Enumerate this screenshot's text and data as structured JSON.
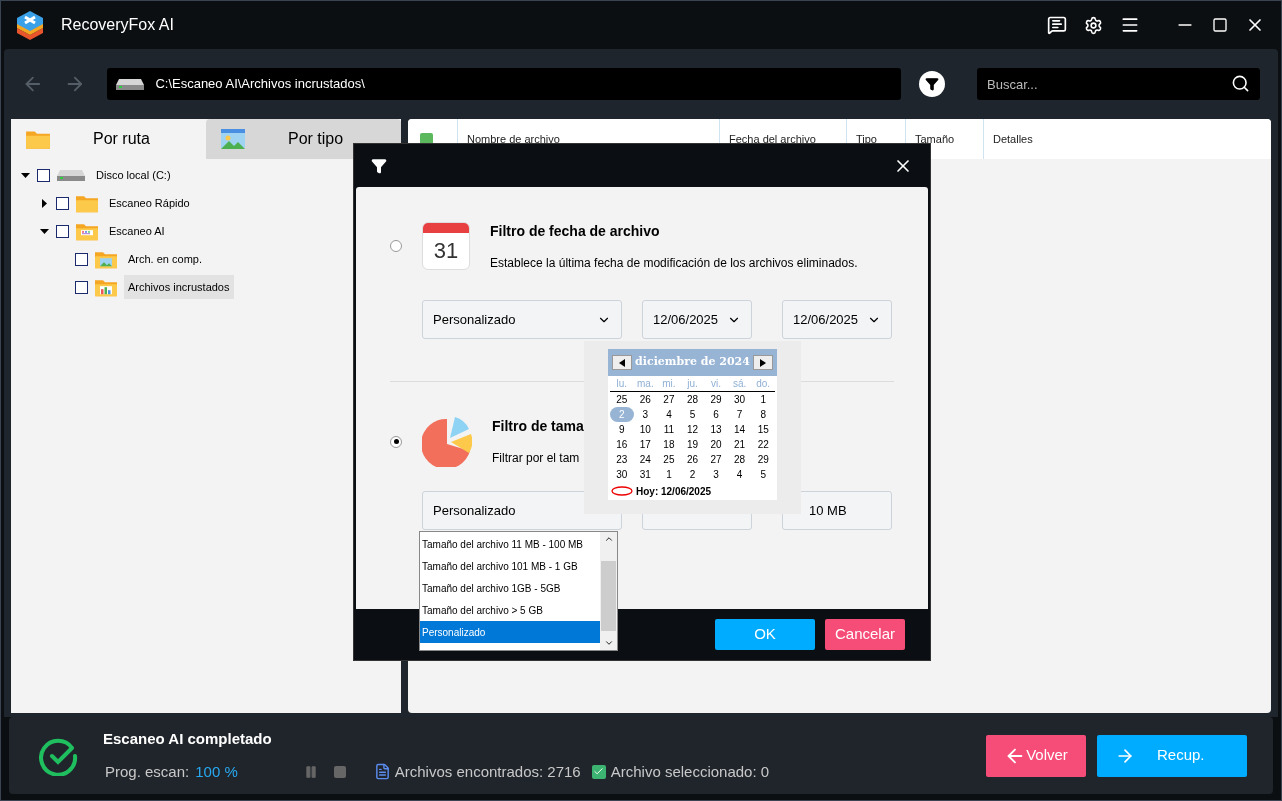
{
  "window": {
    "title": "RecoveryFox AI"
  },
  "toolbar": {
    "path": "C:\\Escaneo AI\\Archivos incrustados\\",
    "search": {
      "placeholder": "Buscar..."
    }
  },
  "tabs": [
    {
      "label": "Por ruta",
      "selected": true,
      "kind": "folder"
    },
    {
      "label": "Por tipo",
      "selected": false,
      "kind": "image"
    }
  ],
  "tree": [
    {
      "label": "Disco local (C:)",
      "kind": "drive",
      "checked": false,
      "expanded": true,
      "selected": false,
      "children": [
        {
          "label": "Escaneo Rápido",
          "kind": "folder",
          "checked": false,
          "expanded": false,
          "selected": false
        },
        {
          "label": "Escaneo AI",
          "kind": "ai-folder",
          "checked": false,
          "expanded": true,
          "selected": false,
          "children": [
            {
              "label": "Arch. en comp.",
              "kind": "image-folder",
              "checked": false,
              "selected": false
            },
            {
              "label": "Archivos incrustados",
              "kind": "chart-folder",
              "checked": false,
              "selected": true
            }
          ]
        }
      ]
    }
  ],
  "table": {
    "select_all": {
      "checked": false
    },
    "columns": [
      "Nombre de archivo",
      "Fecha del archivo",
      "Tipo",
      "Tamaño",
      "Detalles"
    ]
  },
  "filter_dialog": {
    "date_filter": {
      "selected": false,
      "icon_day": "31",
      "title": "Filtro de fecha de archivo",
      "description": "Establece la última fecha de modificación de los archivos eliminados.",
      "preset": "Personalizado",
      "from": "12/06/2025",
      "to": "12/06/2025"
    },
    "size_filter": {
      "selected": true,
      "title": "Filtro de tama",
      "description": "Filtrar por el tam",
      "preset": "Personalizado",
      "max": "10 MB"
    },
    "size_options": [
      {
        "label": "Tamaño del archivo 11 MB - 100 MB",
        "selected": false
      },
      {
        "label": "Tamaño del archivo 101 MB - 1 GB",
        "selected": false
      },
      {
        "label": "Tamaño del archivo 1GB - 5GB",
        "selected": false
      },
      {
        "label": "Tamaño del archivo > 5 GB",
        "selected": false
      },
      {
        "label": "Personalizado",
        "selected": true
      }
    ],
    "calendar": {
      "month": "diciembre de 2024",
      "weekdays": [
        "lu.",
        "ma.",
        "mi.",
        "ju.",
        "vi.",
        "sá.",
        "do."
      ],
      "days": [
        {
          "d": "25",
          "selected": false
        },
        {
          "d": "26",
          "selected": false
        },
        {
          "d": "27",
          "selected": false
        },
        {
          "d": "28",
          "selected": false
        },
        {
          "d": "29",
          "selected": false
        },
        {
          "d": "30",
          "selected": false
        },
        {
          "d": "1",
          "selected": false
        },
        {
          "d": "2",
          "selected": true
        },
        {
          "d": "3",
          "selected": false
        },
        {
          "d": "4",
          "selected": false
        },
        {
          "d": "5",
          "selected": false
        },
        {
          "d": "6",
          "selected": false
        },
        {
          "d": "7",
          "selected": false
        },
        {
          "d": "8",
          "selected": false
        },
        {
          "d": "9",
          "selected": false
        },
        {
          "d": "10",
          "selected": false
        },
        {
          "d": "11",
          "selected": false
        },
        {
          "d": "12",
          "selected": false
        },
        {
          "d": "13",
          "selected": false
        },
        {
          "d": "14",
          "selected": false
        },
        {
          "d": "15",
          "selected": false
        },
        {
          "d": "16",
          "selected": false
        },
        {
          "d": "17",
          "selected": false
        },
        {
          "d": "18",
          "selected": false
        },
        {
          "d": "19",
          "selected": false
        },
        {
          "d": "20",
          "selected": false
        },
        {
          "d": "21",
          "selected": false
        },
        {
          "d": "22",
          "selected": false
        },
        {
          "d": "23",
          "selected": false
        },
        {
          "d": "24",
          "selected": false
        },
        {
          "d": "25",
          "selected": false
        },
        {
          "d": "26",
          "selected": false
        },
        {
          "d": "27",
          "selected": false
        },
        {
          "d": "28",
          "selected": false
        },
        {
          "d": "29",
          "selected": false
        },
        {
          "d": "30",
          "selected": false
        },
        {
          "d": "31",
          "selected": false
        },
        {
          "d": "1",
          "selected": false
        },
        {
          "d": "2",
          "selected": false
        },
        {
          "d": "3",
          "selected": false
        },
        {
          "d": "4",
          "selected": false
        },
        {
          "d": "5",
          "selected": false
        }
      ],
      "today": "Hoy: 12/06/2025"
    },
    "buttons": {
      "ok": "OK",
      "cancel": "Cancelar"
    }
  },
  "status": {
    "title": "Escaneo AI completado",
    "progress_label": "Prog. escan:",
    "progress_value": "100 %",
    "found": "Archivos encontrados: 2716",
    "selected_count": "Archivo seleccionado: 0",
    "back": "Volver",
    "recover": "Recup."
  }
}
